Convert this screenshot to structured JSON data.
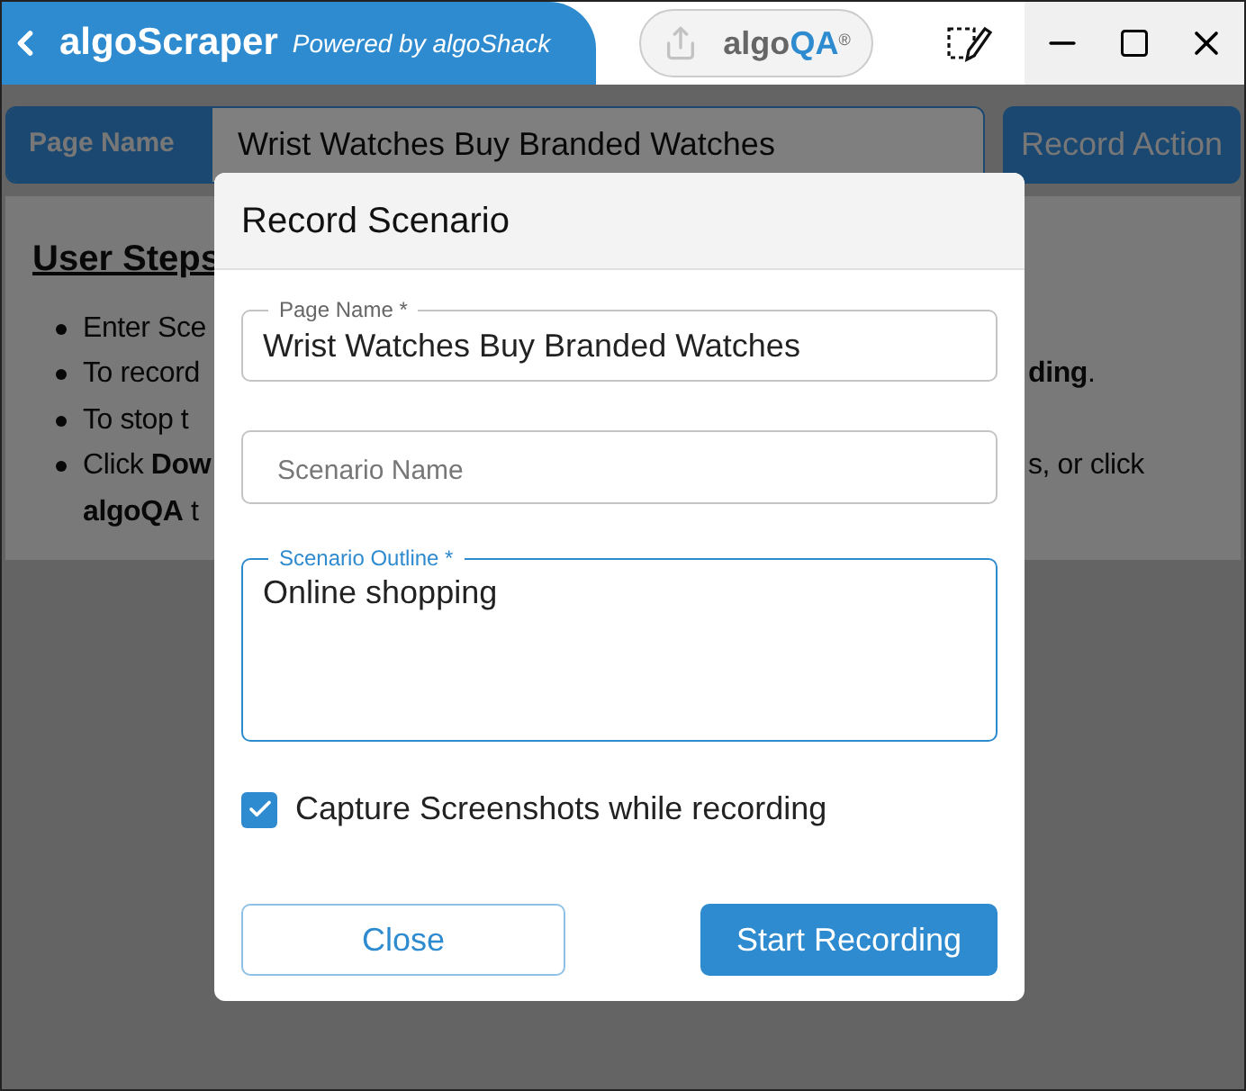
{
  "header": {
    "app_name": "algoScraper",
    "tagline": "Powered by algoShack",
    "logo": {
      "prefix": "algo",
      "suffix": "QA",
      "mark": "®"
    }
  },
  "page_bar": {
    "label": "Page Name",
    "value": "Wrist Watches Buy Branded Watches",
    "action": "Record Action"
  },
  "steps": {
    "heading": "User Steps",
    "lines": [
      {
        "bullet": true,
        "left": "Enter Sce"
      },
      {
        "bullet": true,
        "left": "To record",
        "right": "**ding**."
      },
      {
        "bullet": true,
        "left": "To stop t"
      },
      {
        "bullet": true,
        "left": "Click **Dow**",
        "right": "s, or click"
      },
      {
        "bullet": false,
        "left": "**algoQA** t"
      }
    ]
  },
  "dialog": {
    "title": "Record Scenario",
    "fields": [
      {
        "kind": "input",
        "label": "Page Name *",
        "value": "Wrist Watches Buy Branded Watches",
        "focused": false
      },
      {
        "kind": "input",
        "placeholder": "Scenario Name",
        "focused": false
      },
      {
        "kind": "textarea",
        "label": "Scenario Outline *",
        "value": "Online shopping",
        "focused": true
      }
    ],
    "checkbox": {
      "label": "Capture Screenshots while recording",
      "checked": true
    },
    "buttons": [
      {
        "kind": "secondary",
        "label": "Close"
      },
      {
        "kind": "primary",
        "label": "Start Recording"
      }
    ]
  }
}
